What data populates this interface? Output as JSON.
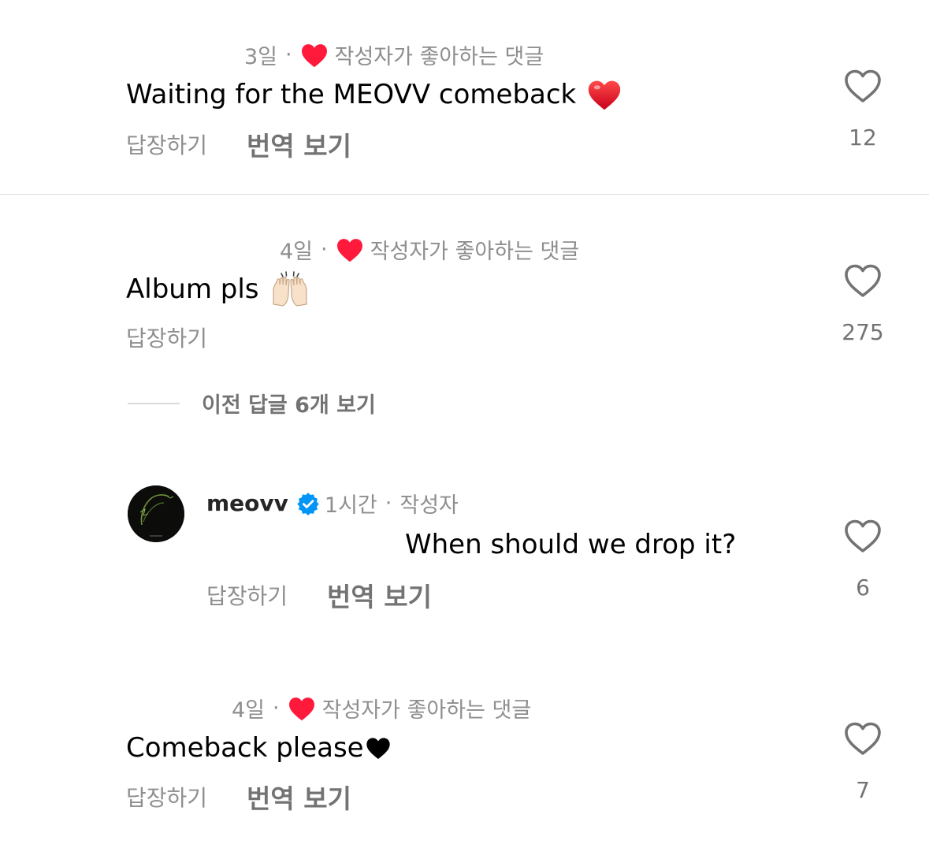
{
  "colors": {
    "like_red": "#ff3040",
    "secondary_text": "#8e8e8e",
    "verified_blue": "#0095f6"
  },
  "comments": [
    {
      "time": "3일",
      "separator": "·",
      "liked_by_creator_label": "작성자가 좋아하는 댓글",
      "text": "Waiting for the MEOVV comeback",
      "emoji": "red-heart-emoji",
      "reply_label": "답장하기",
      "translate_label": "번역 보기",
      "like_count": "12"
    },
    {
      "time": "4일",
      "separator": "·",
      "liked_by_creator_label": "작성자가 좋아하는 댓글",
      "text": "Album pls",
      "emoji": "raising-hands-emoji",
      "reply_label": "답장하기",
      "like_count": "275"
    },
    {
      "time": "4일",
      "separator": "·",
      "liked_by_creator_label": "작성자가 좋아하는 댓글",
      "text": "Comeback please",
      "emoji": "black-heart-emoji",
      "reply_label": "답장하기",
      "translate_label": "번역 보기",
      "like_count": "7"
    }
  ],
  "view_previous_replies": "이전 답글 6개 보기",
  "reply": {
    "username": "meovv",
    "verified_icon": "verified-badge-icon",
    "time": "1시간",
    "separator": "·",
    "role": "작성자",
    "text": "When should we drop it?",
    "reply_label": "답장하기",
    "translate_label": "번역 보기",
    "like_count": "6"
  }
}
